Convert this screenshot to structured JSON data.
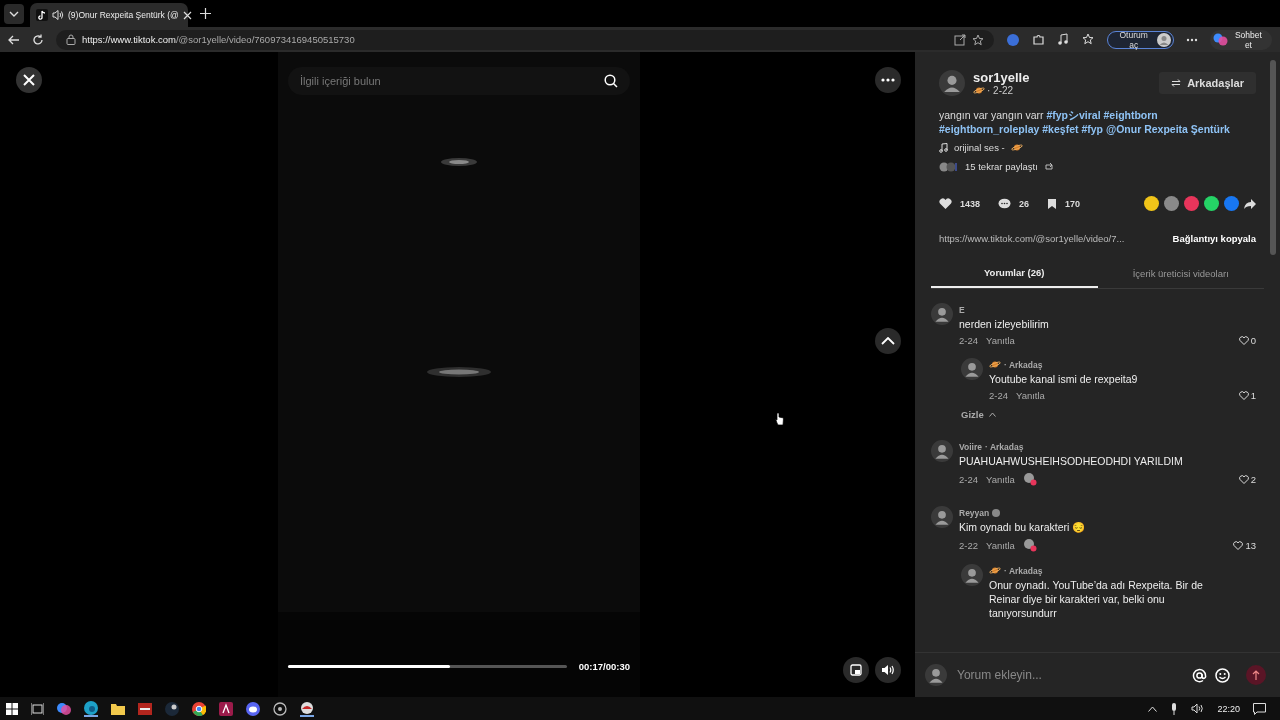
{
  "browser": {
    "tab": {
      "title": "(9)Onur Rexpeita Şentürk (@",
      "audio": true
    },
    "url_host": "https://www.tiktok.com",
    "url_path": "/@sor1yelle/video/7609734169450515730",
    "signin": "Oturum aç",
    "copilot": "Sohbet et"
  },
  "player": {
    "search_placeholder": "İlgili içeriği bulun",
    "time": "00:17/00:30",
    "level": 0.58
  },
  "post": {
    "author": "sor1yelle",
    "date": "· 2-22",
    "follow": "Arkadaşlar",
    "caption": [
      {
        "kind": "plain",
        "text": "yangın var yangın varr"
      },
      {
        "kind": "link",
        "text": "#fypシviral"
      },
      {
        "kind": "link",
        "text": "#eightborn"
      },
      {
        "kind": "link",
        "text": "#eightborn_roleplay"
      },
      {
        "kind": "link",
        "text": "#keşfet"
      },
      {
        "kind": "link",
        "text": "#fyp"
      },
      {
        "kind": "link",
        "text": "@Onur Rexpeita Şentürk"
      }
    ],
    "music": "orijinal ses -",
    "reposts": "15 tekrar paylaştı",
    "stats": {
      "likes": "1438",
      "comments": "26",
      "saves": "170"
    },
    "share": [
      {
        "color": "#f0c419"
      },
      {
        "color": "#8a8a8a"
      },
      {
        "color": "#e8355b"
      },
      {
        "color": "#25d366"
      },
      {
        "color": "#1877f2"
      }
    ],
    "link": "https://www.tiktok.com/@sor1yelle/video/7...",
    "copy": "Bağlantıyı kopyala"
  },
  "tabs": [
    {
      "label": "Yorumlar (26)",
      "selected": true
    },
    {
      "label": "İçerik üreticisi videoları",
      "selected": false
    }
  ],
  "comments": [
    {
      "author": "E",
      "text": "nerden izleyebilirim",
      "date": "2-24",
      "reply": "Yanıtla",
      "likes": "0",
      "children": [
        {
          "tag": "· Arkadaş",
          "text": "Youtube kanal ismi de rexpeita9",
          "date": "2-24",
          "reply": "Yanıtla",
          "likes": "1"
        }
      ],
      "hide": "Gizle"
    },
    {
      "author": "Voiire",
      "tag": "· Arkadaş",
      "text": "PUAHUAHWUSHEIHSODHEODHDI YARILDIM",
      "date": "2-24",
      "reply": "Yanıtla",
      "likes": "2",
      "creator_liked": true
    },
    {
      "author": "Reyyan",
      "verified": true,
      "text": "Kim oynadı bu karakteri 😔",
      "date": "2-22",
      "reply": "Yanıtla",
      "likes": "13",
      "creator_liked": true,
      "children": [
        {
          "tag": "· Arkadaş",
          "text": "Onur oynadı. YouTube’da adı Rexpeita. Bir de Reinar diye bir karakteri var, belki onu tanıyorsundurr"
        }
      ]
    }
  ],
  "composer": {
    "placeholder": "Yorum ekleyin..."
  },
  "taskbar": {
    "time": "22:20"
  }
}
